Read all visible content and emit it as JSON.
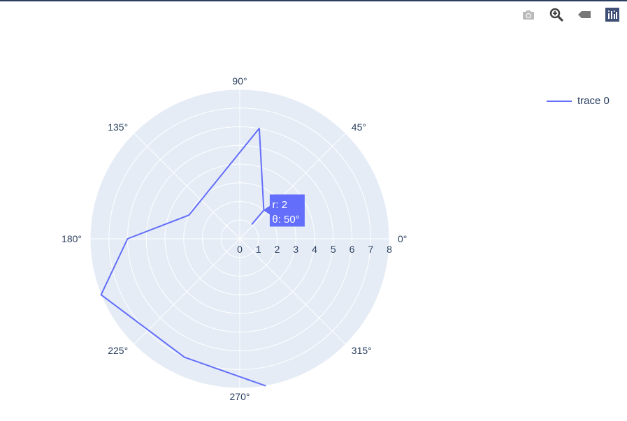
{
  "colors": {
    "grid_bg": "#e5ecf6",
    "grid_line": "#ffffff",
    "trace": "#636efa",
    "text": "#2a3f5f",
    "hover_bg": "#636efa",
    "hover_text": "#ffffff"
  },
  "modebar": {
    "buttons": [
      {
        "name": "camera-icon",
        "title": "Download plot as a png"
      },
      {
        "name": "zoom-icon",
        "title": "Zoom"
      },
      {
        "name": "tag-icon",
        "title": "Toggle show closest data on hover"
      },
      {
        "name": "plotly-logo-icon",
        "title": "Produced with Plotly"
      }
    ]
  },
  "legend": {
    "label": "trace 0"
  },
  "hover": {
    "r_line": "r: 2",
    "theta_line": "θ: 50°"
  },
  "chart_data": {
    "type": "line",
    "subtype": "polar",
    "radial_range": [
      0,
      8
    ],
    "radial_ticks": [
      "0",
      "1",
      "2",
      "3",
      "4",
      "5",
      "6",
      "7",
      "8"
    ],
    "angular_ticks": [
      "0°",
      "45°",
      "90°",
      "135°",
      "180°",
      "225°",
      "270°",
      "315°"
    ],
    "angular_tick_values": [
      0,
      45,
      90,
      135,
      180,
      225,
      270,
      315
    ],
    "grid": true,
    "legend_position": "top-right",
    "series": [
      {
        "name": "trace 0",
        "r": [
          1,
          2,
          6,
          3,
          6,
          8,
          7,
          8
        ],
        "theta": [
          50,
          50,
          80,
          155,
          180,
          202,
          245,
          280
        ]
      }
    ],
    "hover_point_index": 1
  }
}
